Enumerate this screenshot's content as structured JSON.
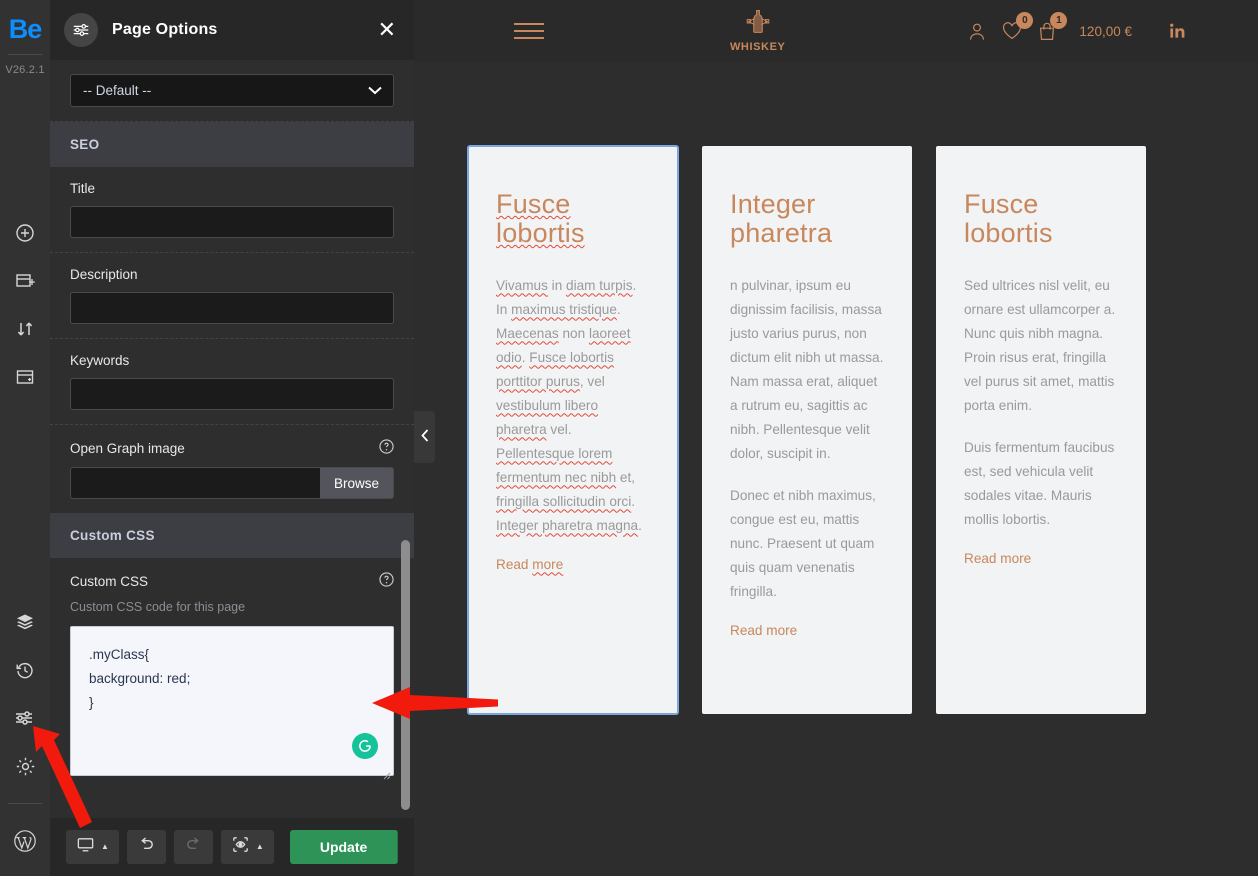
{
  "rail": {
    "logo": "Be",
    "version": "V26.2.1",
    "items": [
      {
        "name": "add-element",
        "icon": "plus-circle-icon"
      },
      {
        "name": "add-section",
        "icon": "add-section-icon"
      },
      {
        "name": "reorder",
        "icon": "sort-arrows-icon"
      },
      {
        "name": "templates",
        "icon": "template-icon"
      }
    ],
    "items_bottom": [
      {
        "name": "layers",
        "icon": "layers-icon"
      },
      {
        "name": "history",
        "icon": "history-clock-icon"
      },
      {
        "name": "page-options",
        "icon": "sliders-icon"
      },
      {
        "name": "settings",
        "icon": "gear-icon"
      }
    ],
    "wordpress": "wordpress-icon"
  },
  "panel": {
    "title": "Page Options",
    "close_label": "✕",
    "layout_select": {
      "value": "-- Default --",
      "options": [
        "-- Default --"
      ]
    },
    "seo": {
      "section_label": "SEO",
      "title_label": "Title",
      "title_value": "",
      "description_label": "Description",
      "description_value": "",
      "keywords_label": "Keywords",
      "keywords_value": "",
      "og_label": "Open Graph image",
      "og_value": "",
      "browse_label": "Browse"
    },
    "custom_css": {
      "section_label": "Custom CSS",
      "field_label": "Custom CSS",
      "help_text": "Custom CSS code for this page",
      "value": ".myClass{\nbackground: red;\n}",
      "grammarly_icon": "grammarly-icon"
    },
    "footer": {
      "responsive_label": "desktop-icon",
      "undo_label": "undo-icon",
      "redo_label": "redo-icon",
      "preview_label": "preview-eye-icon",
      "update_label": "Update"
    },
    "collapse_label": "‹"
  },
  "site": {
    "menu_icon": "hamburger-icon",
    "brand": "WHISKEY",
    "account_icon": "user-icon",
    "wishlist": {
      "icon": "heart-icon",
      "count": "0"
    },
    "cart": {
      "icon": "bag-icon",
      "count": "1",
      "total": "120,00 €"
    },
    "social": {
      "icon": "linkedin-icon",
      "label": "in"
    },
    "cards": [
      {
        "title": "Fusce lobortis",
        "paragraphs": [
          "Vivamus in diam turpis. In maximus tristique. Maecenas non laoreet odio. Fusce lobortis porttitor purus, vel vestibulum libero pharetra vel. Pellentesque lorem fermentum nec nibh et, fringilla sollicitudin orci. Integer pharetra magna."
        ],
        "link": "Read more",
        "selected": true
      },
      {
        "title": "Integer pharetra",
        "paragraphs": [
          "n pulvinar, ipsum eu dignissim facilisis, massa justo varius purus, non dictum elit nibh ut massa. Nam massa erat, aliquet a rutrum eu, sagittis ac nibh. Pellentesque velit dolor, suscipit in.",
          "Donec et nibh maximus, congue est eu, mattis nunc. Praesent ut quam quis quam venenatis fringilla."
        ],
        "link": "Read more",
        "selected": false
      },
      {
        "title": "Fusce lobortis",
        "paragraphs": [
          "Sed ultrices nisl velit, eu ornare est ullamcorper a. Nunc quis nibh magna. Proin risus erat, fringilla vel purus sit amet, mattis porta enim.",
          "Duis fermentum faucibus est, sed vehicula velit sodales vitae. Mauris mollis lobortis."
        ],
        "link": "Read more",
        "selected": false
      }
    ]
  },
  "colors": {
    "accent_blue": "#0c8eff",
    "brand_copper": "#c8875c",
    "update_green": "#2e9356",
    "annotation_red": "#f21a0d",
    "selection_blue": "#7aa7e0",
    "grammarly_green": "#15c39a"
  }
}
